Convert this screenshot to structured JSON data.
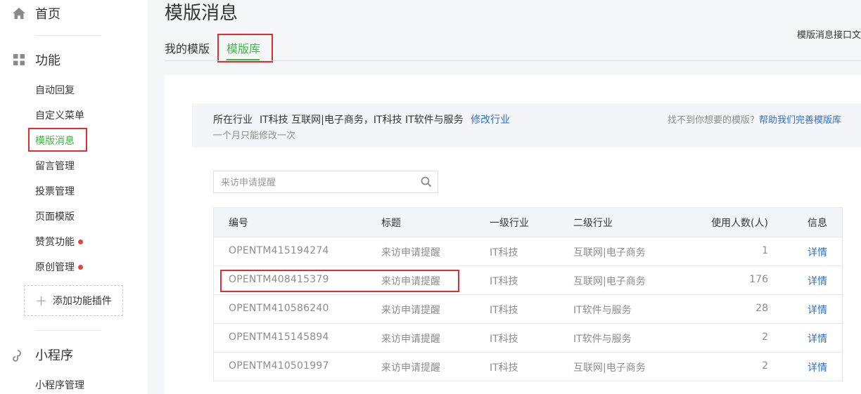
{
  "sidebar": {
    "home_label": "首页",
    "features_label": "功能",
    "items": [
      {
        "label": "自动回复"
      },
      {
        "label": "自定义菜单"
      },
      {
        "label": "模版消息"
      },
      {
        "label": "留言管理"
      },
      {
        "label": "投票管理"
      },
      {
        "label": "页面模版"
      },
      {
        "label": "赞赏功能"
      },
      {
        "label": "原创管理"
      }
    ],
    "add_plugin_label": "添加功能插件",
    "miniprogram_label": "小程序",
    "miniprogram_items": [
      {
        "label": "小程序管理"
      }
    ]
  },
  "header": {
    "title": "模版消息",
    "tabs": [
      {
        "label": "我的模版"
      },
      {
        "label": "模版库"
      }
    ],
    "doc_link": "模版消息接口文"
  },
  "info": {
    "industry_prefix": "所在行业",
    "industry_primary": "IT科技 互联网|电子商务，IT科技 IT软件与服务",
    "modify_link": "修改行业",
    "hint": "一个月只能修改一次",
    "help_text": "找不到你想要的模版？",
    "help_link": "帮助我们完善模版库"
  },
  "search": {
    "placeholder": "来访申请提醒"
  },
  "table": {
    "headers": [
      "编号",
      "标题",
      "一级行业",
      "二级行业",
      "使用人数(人)",
      "信息"
    ],
    "rows": [
      {
        "id": "OPENTM415194274",
        "title": "来访申请提醒",
        "industry1": "IT科技",
        "industry2": "互联网|电子商务",
        "users": "1",
        "action": "详情"
      },
      {
        "id": "OPENTM408415379",
        "title": "来访申请提醒",
        "industry1": "IT科技",
        "industry2": "互联网|电子商务",
        "users": "176",
        "action": "详情"
      },
      {
        "id": "OPENTM410586240",
        "title": "来访申请提醒",
        "industry1": "IT科技",
        "industry2": "IT软件与服务",
        "users": "28",
        "action": "详情"
      },
      {
        "id": "OPENTM415145894",
        "title": "来访申请提醒",
        "industry1": "IT科技",
        "industry2": "IT软件与服务",
        "users": "2",
        "action": "详情"
      },
      {
        "id": "OPENTM410501997",
        "title": "来访申请提醒",
        "industry1": "IT科技",
        "industry2": "互联网|电子商务",
        "users": "2",
        "action": "详情"
      }
    ]
  },
  "colors": {
    "accent": "#44b549",
    "link": "#2d6fd0",
    "highlight": "#e02d2d",
    "dot": "#e64340"
  },
  "icons": [
    "home-icon",
    "grid-icon",
    "plus-icon",
    "search-icon",
    "link-icon"
  ]
}
